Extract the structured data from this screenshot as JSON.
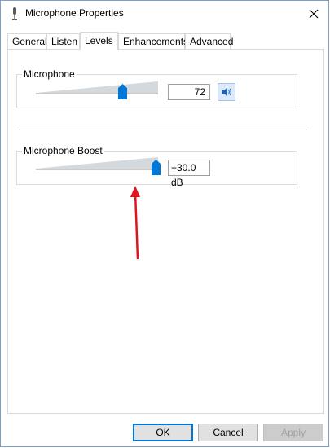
{
  "window": {
    "title": "Microphone Properties",
    "icon": "microphone-icon",
    "close_icon": "close-icon"
  },
  "tabs": [
    {
      "label": "General",
      "active": false
    },
    {
      "label": "Listen",
      "active": false
    },
    {
      "label": "Levels",
      "active": true
    },
    {
      "label": "Enhancements",
      "active": false
    },
    {
      "label": "Advanced",
      "active": false
    }
  ],
  "levels": {
    "microphone": {
      "label": "Microphone",
      "value": "72",
      "level_percent": 72,
      "mute_icon": "speaker-icon"
    },
    "boost": {
      "label": "Microphone Boost",
      "value": "+30.0 dB",
      "level_percent": 100
    }
  },
  "annotation": {
    "arrow_color": "#e0141e"
  },
  "buttons": {
    "ok": "OK",
    "cancel": "Cancel",
    "apply": "Apply"
  },
  "colors": {
    "accent": "#0078d7",
    "default_button_border": "#0078d7"
  }
}
